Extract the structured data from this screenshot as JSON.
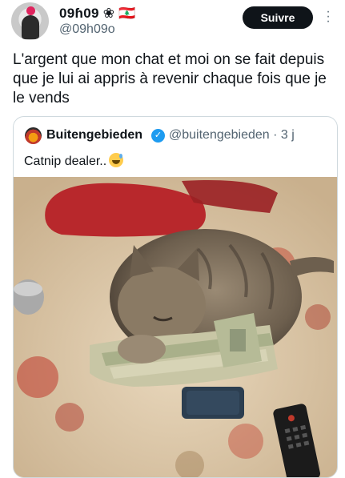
{
  "author": {
    "display_name": "09ɦ09 ❀ 🇱🇧",
    "handle": "@09h09o",
    "avatar_icon": "avatar-image"
  },
  "follow_button": {
    "label": "Suivre"
  },
  "more_icon": "more-vertical-icon",
  "tweet": {
    "text": "L'argent que mon chat et moi on se fait depuis que je lui ai appris à revenir chaque fois que je le vends"
  },
  "quoted": {
    "display_name": "Buitengebieden",
    "verified_icon": "verified-badge-icon",
    "handle_time": "@buitengebieden · 3 j",
    "text": "Catnip dealer..",
    "emoji_icon": "sweat-smile-emoji-icon"
  },
  "media": {
    "icon": "cat-on-money-photo"
  }
}
